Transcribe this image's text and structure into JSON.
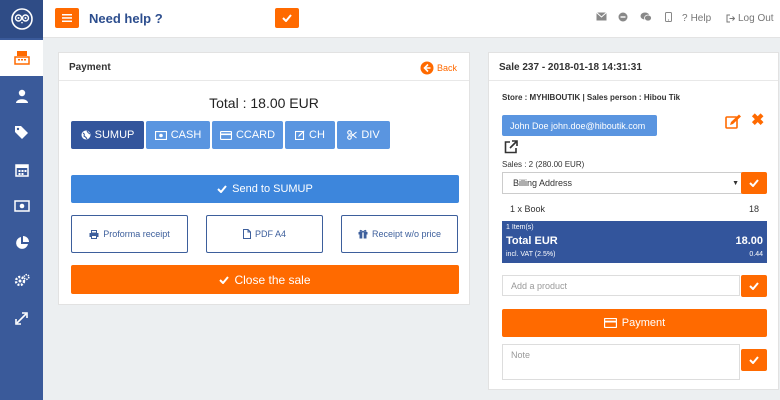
{
  "colors": {
    "sidebar": "#3a5a9a",
    "accent": "#ff6a00",
    "primary": "#33559c",
    "button_blue": "#5a95e0"
  },
  "sidebar": {
    "items": [
      {
        "icon": "cash-register-icon",
        "active": true
      },
      {
        "icon": "user-icon",
        "active": false
      },
      {
        "icon": "tags-icon",
        "active": false
      },
      {
        "icon": "calendar-icon",
        "active": false
      },
      {
        "icon": "money-icon",
        "active": false
      },
      {
        "icon": "pie-chart-icon",
        "active": false
      },
      {
        "icon": "cogs-icon",
        "active": false
      },
      {
        "icon": "expand-icon",
        "active": false
      }
    ]
  },
  "header": {
    "help_title": "Need help ?",
    "help_link": "Help",
    "logout_link": "Log Out"
  },
  "payment_panel": {
    "title": "Payment",
    "back_label": "Back",
    "total": "Total : 18.00 EUR",
    "methods": [
      "SUMUP",
      "CASH",
      "CCARD",
      "CH",
      "DIV"
    ],
    "active_method": "SUMUP",
    "send_label": "Send to SUMUP",
    "proforma_label": "Proforma receipt",
    "pdf_label": "PDF A4",
    "receipt_label": "Receipt w/o price",
    "close_label": "Close the sale"
  },
  "sale_panel": {
    "title": "Sale 237 - 2018-01-18 14:31:31",
    "store_line": "Store : MYHIBOUTIK | Sales person : Hibou Tik",
    "customer": "John Doe john.doe@hiboutik.com",
    "sales_count": "Sales : 2 (280.00 EUR)",
    "billing_value": "Billing Address",
    "line_item": {
      "qty_name": "1 x Book",
      "price": "18"
    },
    "items_count": "1 Item(s)",
    "total_label": "Total EUR",
    "total_value": "18.00",
    "vat_label": "incl. VAT (2.5%)",
    "vat_value": "0.44",
    "add_product_placeholder": "Add a product",
    "payment_label": "Payment",
    "note_placeholder": "Note"
  }
}
